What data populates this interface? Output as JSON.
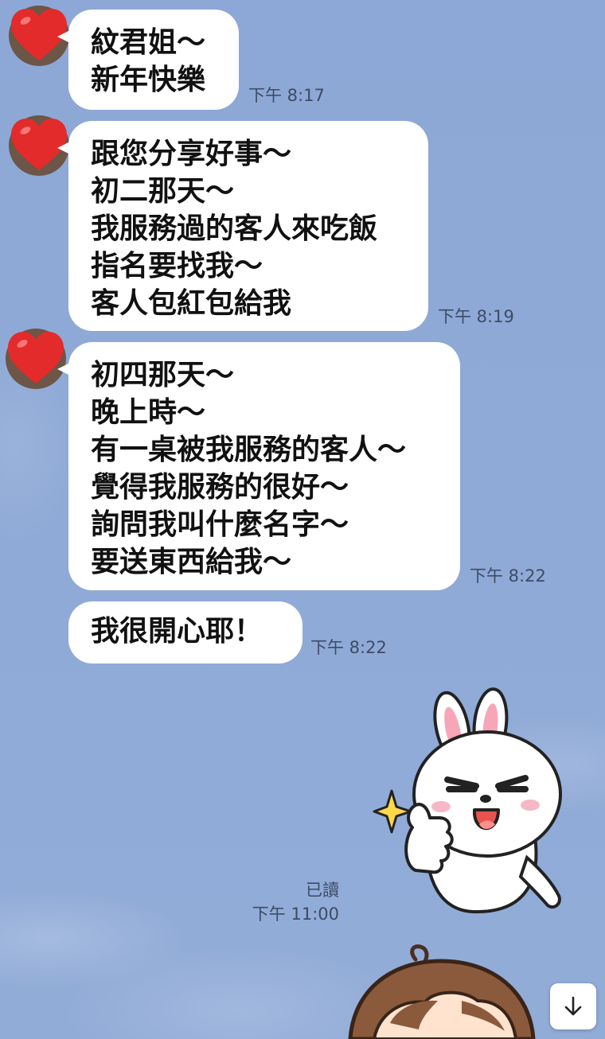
{
  "theme": {
    "background": "#8fa9d6",
    "bubble": "#ffffff",
    "heart": "#e32b2b",
    "timestamp_color": "#3d4b66"
  },
  "messages": [
    {
      "lines": [
        "紋君姐～",
        "新年快樂"
      ],
      "time": "下午 8:17"
    },
    {
      "lines": [
        "跟您分享好事～",
        "初二那天～",
        "我服務過的客人來吃飯",
        "指名要找我～",
        "客人包紅包給我"
      ],
      "time": "下午 8:19"
    },
    {
      "lines": [
        "初四那天～",
        "晚上時～",
        "有一桌被我服務的客人～",
        "覺得我服務的很好～",
        "詢問我叫什麼名字～",
        "要送東西給我～"
      ],
      "time": "下午 8:22"
    },
    {
      "lines": [
        "我很開心耶！"
      ],
      "time": "下午 8:22"
    }
  ],
  "reply": {
    "sticker_icon": "bunny-thumbs-up-sticker",
    "read_label": "已讀",
    "time": "下午 11:00"
  },
  "icons": {
    "avatar": "heart-avatar-icon",
    "scroll": "arrow-down-icon"
  }
}
